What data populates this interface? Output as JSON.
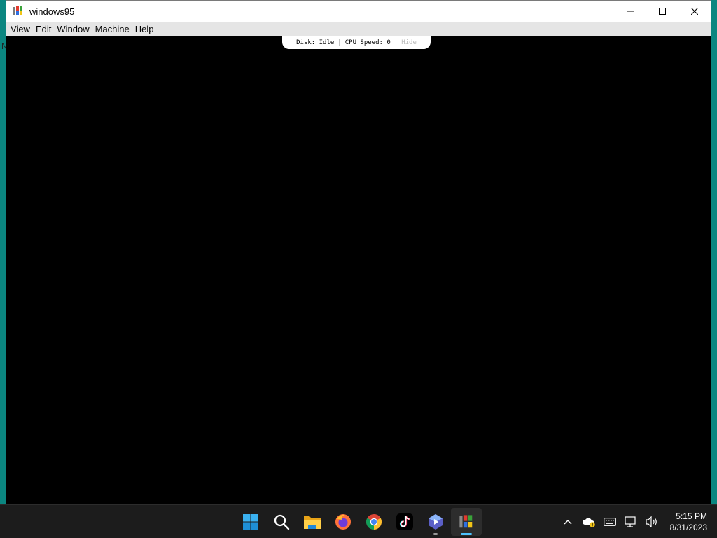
{
  "window": {
    "title": "windows95",
    "controls": {
      "minimize": "minimize-icon",
      "maximize": "maximize-icon",
      "close": "close-icon"
    }
  },
  "menu": [
    "View",
    "Edit",
    "Window",
    "Machine",
    "Help"
  ],
  "desktop_glyph": "N",
  "status": {
    "disk": "Disk: Idle",
    "cpu": "CPU Speed: 0",
    "separator": "|",
    "hide": "Hide"
  },
  "taskbar": {
    "apps": [
      {
        "name": "start-icon"
      },
      {
        "name": "search-icon"
      },
      {
        "name": "file-explorer-icon"
      },
      {
        "name": "firefox-icon"
      },
      {
        "name": "chrome-icon"
      },
      {
        "name": "tiktok-icon"
      },
      {
        "name": "clipchamp-icon"
      },
      {
        "name": "windows95-icon"
      }
    ],
    "tray": [
      "show-hidden-icons-chevron-icon",
      "onedrive-warning-icon",
      "keyboard-icon",
      "network-icon",
      "volume-icon"
    ],
    "time": "5:15 PM",
    "date": "8/31/2023"
  },
  "colors": {
    "desktop": "#0e7e7e",
    "taskbar": "#1c1c1c",
    "accent": "#4cc2ff"
  }
}
